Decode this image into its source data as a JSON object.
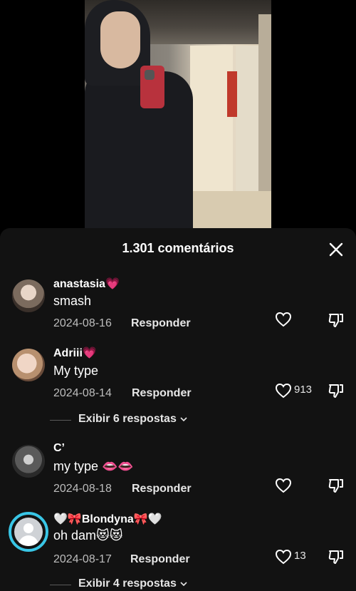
{
  "sheet": {
    "title": "1.301 comentários",
    "close_icon": "close-icon"
  },
  "comments": [
    {
      "username": "anastasia💗",
      "text": "smash",
      "date": "2024-08-16",
      "reply_label": "Responder",
      "likes": ""
    },
    {
      "username": "Adriii💗",
      "text": "My type",
      "date": "2024-08-14",
      "reply_label": "Responder",
      "likes": "913",
      "replies_label": "Exibir 6 respostas"
    },
    {
      "username": "C’",
      "text": "my type 👄👄",
      "date": "2024-08-18",
      "reply_label": "Responder",
      "likes": ""
    },
    {
      "username": "🤍🎀Blondyna🎀🤍",
      "text": "oh dam😻😻",
      "date": "2024-08-17",
      "reply_label": "Responder",
      "likes": "13",
      "replies_label": "Exibir 4 respostas"
    }
  ],
  "colors": {
    "sheet_bg": "#121212",
    "story_ring": "#39c6e6",
    "secondary_text": "#bdbdbd"
  },
  "icons": [
    "heart-icon",
    "dislike-icon",
    "chevron-down-icon",
    "close-icon",
    "default-avatar-icon"
  ]
}
